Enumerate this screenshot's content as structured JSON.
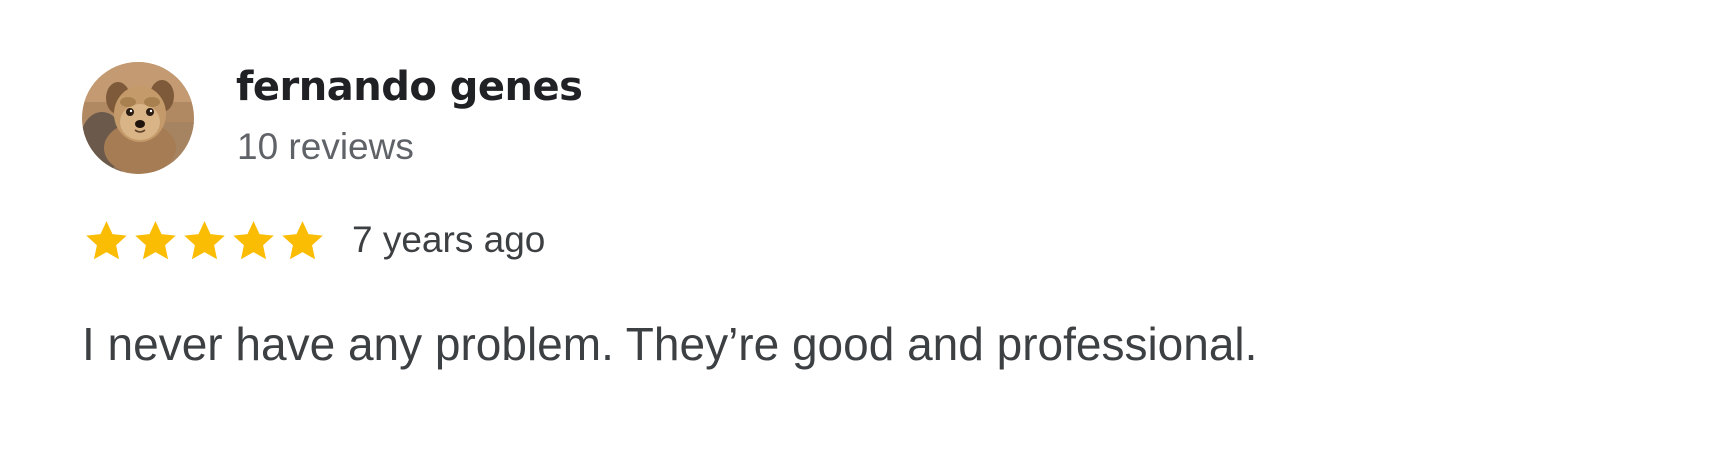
{
  "review": {
    "reviewer_name": "fernando genes",
    "review_count": "10 reviews",
    "rating": 5,
    "max_rating": 5,
    "date": "7 years ago",
    "text": "I never have any problem. They’re good and professional.",
    "avatar_icon": "dog-photo-avatar",
    "star_icon": "star-icon"
  },
  "colors": {
    "star": "#fbbc04",
    "name": "#202124",
    "secondary_text": "#5f6368",
    "body_text": "#3c4043",
    "background": "#ffffff"
  }
}
